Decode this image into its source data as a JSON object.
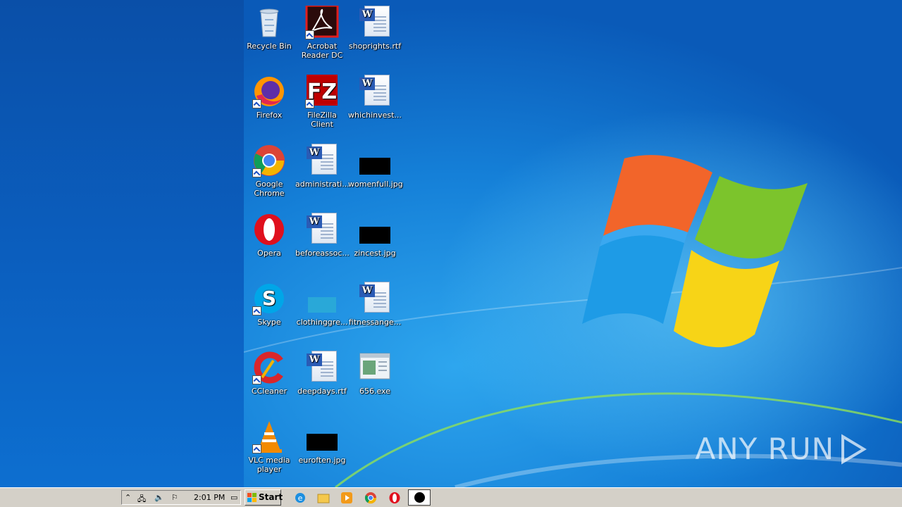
{
  "desktop": {
    "icons": [
      {
        "label": "Recycle Bin",
        "icon": "recycle-bin-icon"
      },
      {
        "label": "Acrobat Reader DC",
        "icon": "acrobat-icon"
      },
      {
        "label": "shoprights.rtf",
        "icon": "word-document-icon"
      },
      {
        "label": "Firefox",
        "icon": "firefox-icon"
      },
      {
        "label": "FileZilla Client",
        "icon": "filezilla-icon"
      },
      {
        "label": "whichinvest...",
        "icon": "word-document-icon"
      },
      {
        "label": "Google Chrome",
        "icon": "chrome-icon"
      },
      {
        "label": "administrati...",
        "icon": "word-document-icon"
      },
      {
        "label": "womenfull.jpg",
        "icon": "image-file-icon"
      },
      {
        "label": "Opera",
        "icon": "opera-icon"
      },
      {
        "label": "beforeassoc...",
        "icon": "word-document-icon"
      },
      {
        "label": "zincest.jpg",
        "icon": "image-file-icon"
      },
      {
        "label": "Skype",
        "icon": "skype-icon"
      },
      {
        "label": "clothinggre...",
        "icon": "file-icon"
      },
      {
        "label": "fitnessange...",
        "icon": "word-document-icon"
      },
      {
        "label": "CCleaner",
        "icon": "ccleaner-icon"
      },
      {
        "label": "deepdays.rtf",
        "icon": "word-document-icon"
      },
      {
        "label": "656.exe",
        "icon": "exe-icon"
      },
      {
        "label": "VLC media player",
        "icon": "vlc-icon"
      },
      {
        "label": "euroften.jpg",
        "icon": "image-file-icon"
      }
    ],
    "watermark": "ANY RUN"
  },
  "taskbar": {
    "start_label": "Start",
    "clock": "2:01 PM",
    "quick_launch": [
      "internet-explorer-icon",
      "folder-icon",
      "media-player-icon",
      "chrome-icon",
      "opera-icon",
      "record-icon"
    ]
  },
  "colors": {
    "desktop_blue": "#1580d8",
    "left_panel": "#0b5fbf",
    "taskbar": "#d4d0c8"
  }
}
